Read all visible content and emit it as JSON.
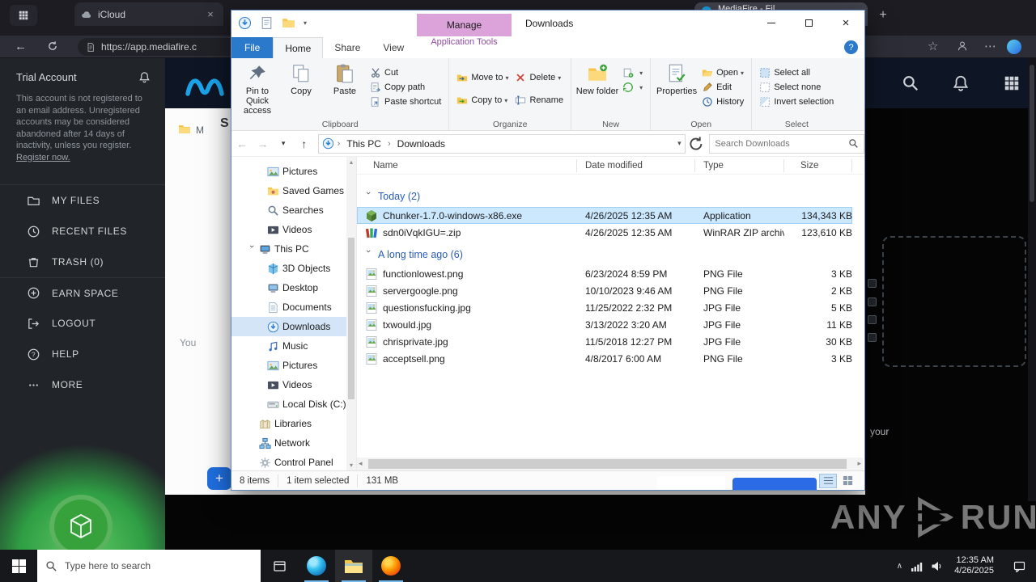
{
  "browser": {
    "tabs": [
      {
        "title": "iCloud"
      },
      {
        "title": "MediaFire - Fil"
      }
    ],
    "new_tab_glyph": "+",
    "url": "https://app.mediafire.c"
  },
  "mediafire": {
    "trial_title": "Trial Account",
    "trial_text": "This account is not registered to an email address. Unregistered accounts may be considered abandoned after 14 days of inactivity, unless you register.",
    "register_link": "Register now.",
    "menu": [
      {
        "label": "MY FILES",
        "icon": "folder"
      },
      {
        "label": "RECENT FILES",
        "icon": "clock"
      },
      {
        "label": "TRASH (0)",
        "icon": "trash"
      },
      {
        "label": "EARN SPACE",
        "icon": "plus"
      },
      {
        "label": "LOGOUT",
        "icon": "logout"
      },
      {
        "label": "HELP",
        "icon": "help"
      },
      {
        "label": "MORE",
        "icon": "more"
      }
    ],
    "fragments": {
      "heading": "S",
      "crumb": "M",
      "left_text": "You",
      "right_text": "your",
      "add_button": "+"
    }
  },
  "explorer": {
    "window_title": "Downloads",
    "contextual_header": "Manage",
    "contextual_tab": "Application Tools",
    "tabs": [
      "File",
      "Home",
      "Share",
      "View"
    ],
    "help_glyph": "?",
    "ribbon": {
      "pin": "Pin to Quick access",
      "copy": "Copy",
      "paste": "Paste",
      "cut": "Cut",
      "copy_path": "Copy path",
      "paste_shortcut": "Paste shortcut",
      "move_to": "Move to",
      "copy_to": "Copy to",
      "delete": "Delete",
      "rename": "Rename",
      "new_folder": "New folder",
      "properties": "Properties",
      "open": "Open",
      "edit": "Edit",
      "history": "History",
      "select_all": "Select all",
      "select_none": "Select none",
      "invert_selection": "Invert selection",
      "group_labels": {
        "clipboard": "Clipboard",
        "organize": "Organize",
        "new": "New",
        "open": "Open",
        "select": "Select"
      }
    },
    "address": {
      "crumbs": [
        "This PC",
        "Downloads"
      ],
      "search_placeholder": "Search Downloads"
    },
    "nav": [
      {
        "label": "Pictures",
        "icon": "pictures",
        "level": 2
      },
      {
        "label": "Saved Games",
        "icon": "saved-games",
        "level": 2
      },
      {
        "label": "Searches",
        "icon": "searches",
        "level": 2
      },
      {
        "label": "Videos",
        "icon": "videos",
        "level": 2
      },
      {
        "label": "This PC",
        "icon": "pc",
        "level": 1,
        "expanded": true
      },
      {
        "label": "3D Objects",
        "icon": "objects3d",
        "level": 2
      },
      {
        "label": "Desktop",
        "icon": "desktop",
        "level": 2
      },
      {
        "label": "Documents",
        "icon": "documents",
        "level": 2
      },
      {
        "label": "Downloads",
        "icon": "downloads",
        "level": 2,
        "selected": true
      },
      {
        "label": "Music",
        "icon": "music",
        "level": 2
      },
      {
        "label": "Pictures",
        "icon": "pictures",
        "level": 2
      },
      {
        "label": "Videos",
        "icon": "videos",
        "level": 2
      },
      {
        "label": "Local Disk (C:)",
        "icon": "disk",
        "level": 2
      },
      {
        "label": "Libraries",
        "icon": "libraries",
        "level": 1
      },
      {
        "label": "Network",
        "icon": "network",
        "level": 1
      },
      {
        "label": "Control Panel",
        "icon": "controlpanel",
        "level": 1
      }
    ],
    "columns": [
      "Name",
      "Date modified",
      "Type",
      "Size"
    ],
    "groups": [
      {
        "name": "Today (2)",
        "rows": [
          {
            "icon": "exe",
            "name": "Chunker-1.7.0-windows-x86.exe",
            "date": "4/26/2025 12:35 AM",
            "type": "Application",
            "size": "134,343 KB",
            "selected": true
          },
          {
            "icon": "zip",
            "name": "sdn0iVqkIGU=.zip",
            "date": "4/26/2025 12:35 AM",
            "type": "WinRAR ZIP archive",
            "size": "123,610 KB"
          }
        ]
      },
      {
        "name": "A long time ago (6)",
        "rows": [
          {
            "icon": "img",
            "name": "functionlowest.png",
            "date": "6/23/2024 8:59 PM",
            "type": "PNG File",
            "size": "3 KB"
          },
          {
            "icon": "img",
            "name": "servergoogle.png",
            "date": "10/10/2023 9:46 AM",
            "type": "PNG File",
            "size": "2 KB"
          },
          {
            "icon": "img",
            "name": "questionsfucking.jpg",
            "date": "11/25/2022 2:32 PM",
            "type": "JPG File",
            "size": "5 KB"
          },
          {
            "icon": "img",
            "name": "txwould.jpg",
            "date": "3/13/2022 3:20 AM",
            "type": "JPG File",
            "size": "11 KB"
          },
          {
            "icon": "img",
            "name": "chrisprivate.jpg",
            "date": "11/5/2018 12:27 PM",
            "type": "JPG File",
            "size": "30 KB"
          },
          {
            "icon": "img",
            "name": "acceptsell.png",
            "date": "4/8/2017 6:00 AM",
            "type": "PNG File",
            "size": "3 KB"
          }
        ]
      }
    ],
    "status": {
      "items": "8 items",
      "selected": "1 item selected",
      "size": "131 MB"
    }
  },
  "taskbar": {
    "search_placeholder": "Type here to search",
    "time": "12:35 AM",
    "date": "4/26/2025"
  },
  "watermark": {
    "any": "ANY",
    "run": "RUN"
  }
}
